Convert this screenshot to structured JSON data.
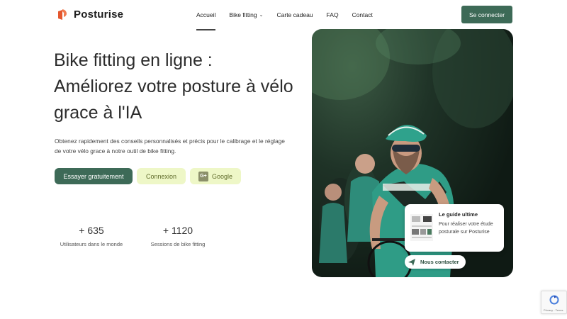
{
  "header": {
    "brand": "Posturise",
    "nav": [
      "Accueil",
      "Bike fitting",
      "Carte cadeau",
      "FAQ",
      "Contact"
    ],
    "login_label": "Se connecter",
    "accent": "#3d6a57",
    "logo_color": "#e4572e"
  },
  "hero": {
    "title": "Bike fitting en ligne : Améliorez votre posture à vélo grace à l'IA",
    "subtitle": "Obtenez rapidement des conseils personnalisés et précis pour le calibrage et le réglage de votre vélo grace à notre outil de bike fitting.",
    "try_label": "Essayer gratuitement",
    "connexion_label": "Connexion",
    "google_label": "Google",
    "google_icon_text": "G+"
  },
  "stats": [
    {
      "value": "+ 635",
      "label": "Utilisateurs dans le monde"
    },
    {
      "value": "+ 1120",
      "label": "Sessions de bike fitting"
    }
  ],
  "guide": {
    "title": "Le guide ultime",
    "text": "Pour réaliser votre étude posturale sur Posturise"
  },
  "contact": {
    "label": "Nous contacter",
    "icon": "send-icon"
  },
  "recaptcha": {
    "label": "Privacy - Terms"
  }
}
